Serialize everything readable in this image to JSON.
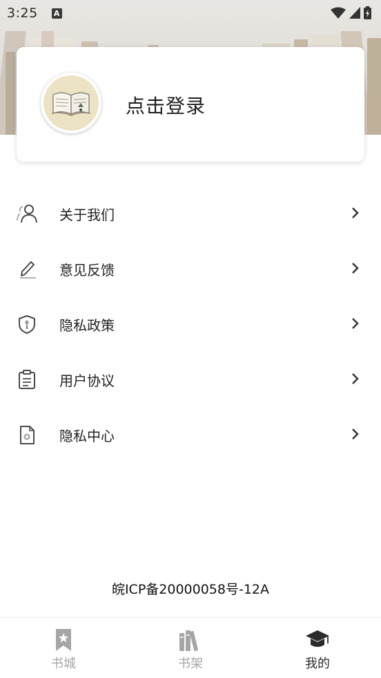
{
  "status_bar": {
    "time": "3:25",
    "notification_icon": "a-letter-icon",
    "right_icons": [
      "wifi-icon",
      "cellular-signal-icon",
      "battery-icon"
    ]
  },
  "login_card": {
    "avatar_icon": "open-book-icon",
    "login_label": "点击登录"
  },
  "menu": {
    "items": [
      {
        "label": "关于我们",
        "icon": "users-icon"
      },
      {
        "label": "意见反馈",
        "icon": "pencil-icon"
      },
      {
        "label": "隐私政策",
        "icon": "shield-icon"
      },
      {
        "label": "用户协议",
        "icon": "clipboard-icon"
      },
      {
        "label": "隐私中心",
        "icon": "gear-document-icon"
      }
    ]
  },
  "footer": {
    "icp": "皖ICP备20000058号-12A"
  },
  "tab_bar": {
    "tabs": [
      {
        "label": "书城",
        "icon": "bookmark-icon",
        "active": false
      },
      {
        "label": "书架",
        "icon": "bookshelf-icon",
        "active": false
      },
      {
        "label": "我的",
        "icon": "graduation-cap-icon",
        "active": true
      }
    ]
  },
  "colors": {
    "text_primary": "#222222",
    "tab_inactive": "#a6a6a6",
    "tab_active": "#2b2b2b",
    "icon_color": "#4a4a4a"
  }
}
